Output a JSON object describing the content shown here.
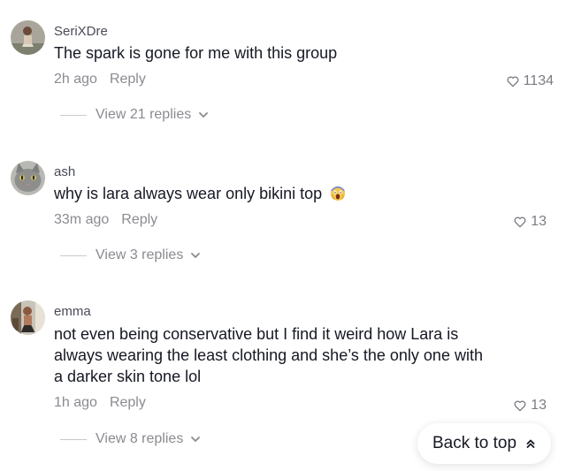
{
  "comments": [
    {
      "username": "SeriXDre",
      "text": "The spark is gone for me with this group",
      "time": "2h ago",
      "reply_label": "Reply",
      "likes": "1134",
      "view_replies": "View 21 replies",
      "avatar_icon": "user-avatar-icon"
    },
    {
      "username": "ash",
      "text": "why is lara always wear only bikini top",
      "emoji": "screaming-face-emoji",
      "time": "33m ago",
      "reply_label": "Reply",
      "likes": "13",
      "view_replies": "View 3 replies",
      "avatar_icon": "cat-avatar-icon"
    },
    {
      "username": "emma",
      "text": "not even being conservative but I find it weird how Lara is always wearing the least clothing and she’s the only one with a darker skin tone lol",
      "time": "1h ago",
      "reply_label": "Reply",
      "likes": "13",
      "view_replies": "View 8 replies",
      "avatar_icon": "user-avatar-icon"
    }
  ],
  "back_to_top": {
    "label": "Back to top",
    "icon": "double-chevron-up-icon"
  },
  "colors": {
    "text_primary": "#161823",
    "text_secondary": "#8a8b91",
    "username": "#4a4c57"
  }
}
